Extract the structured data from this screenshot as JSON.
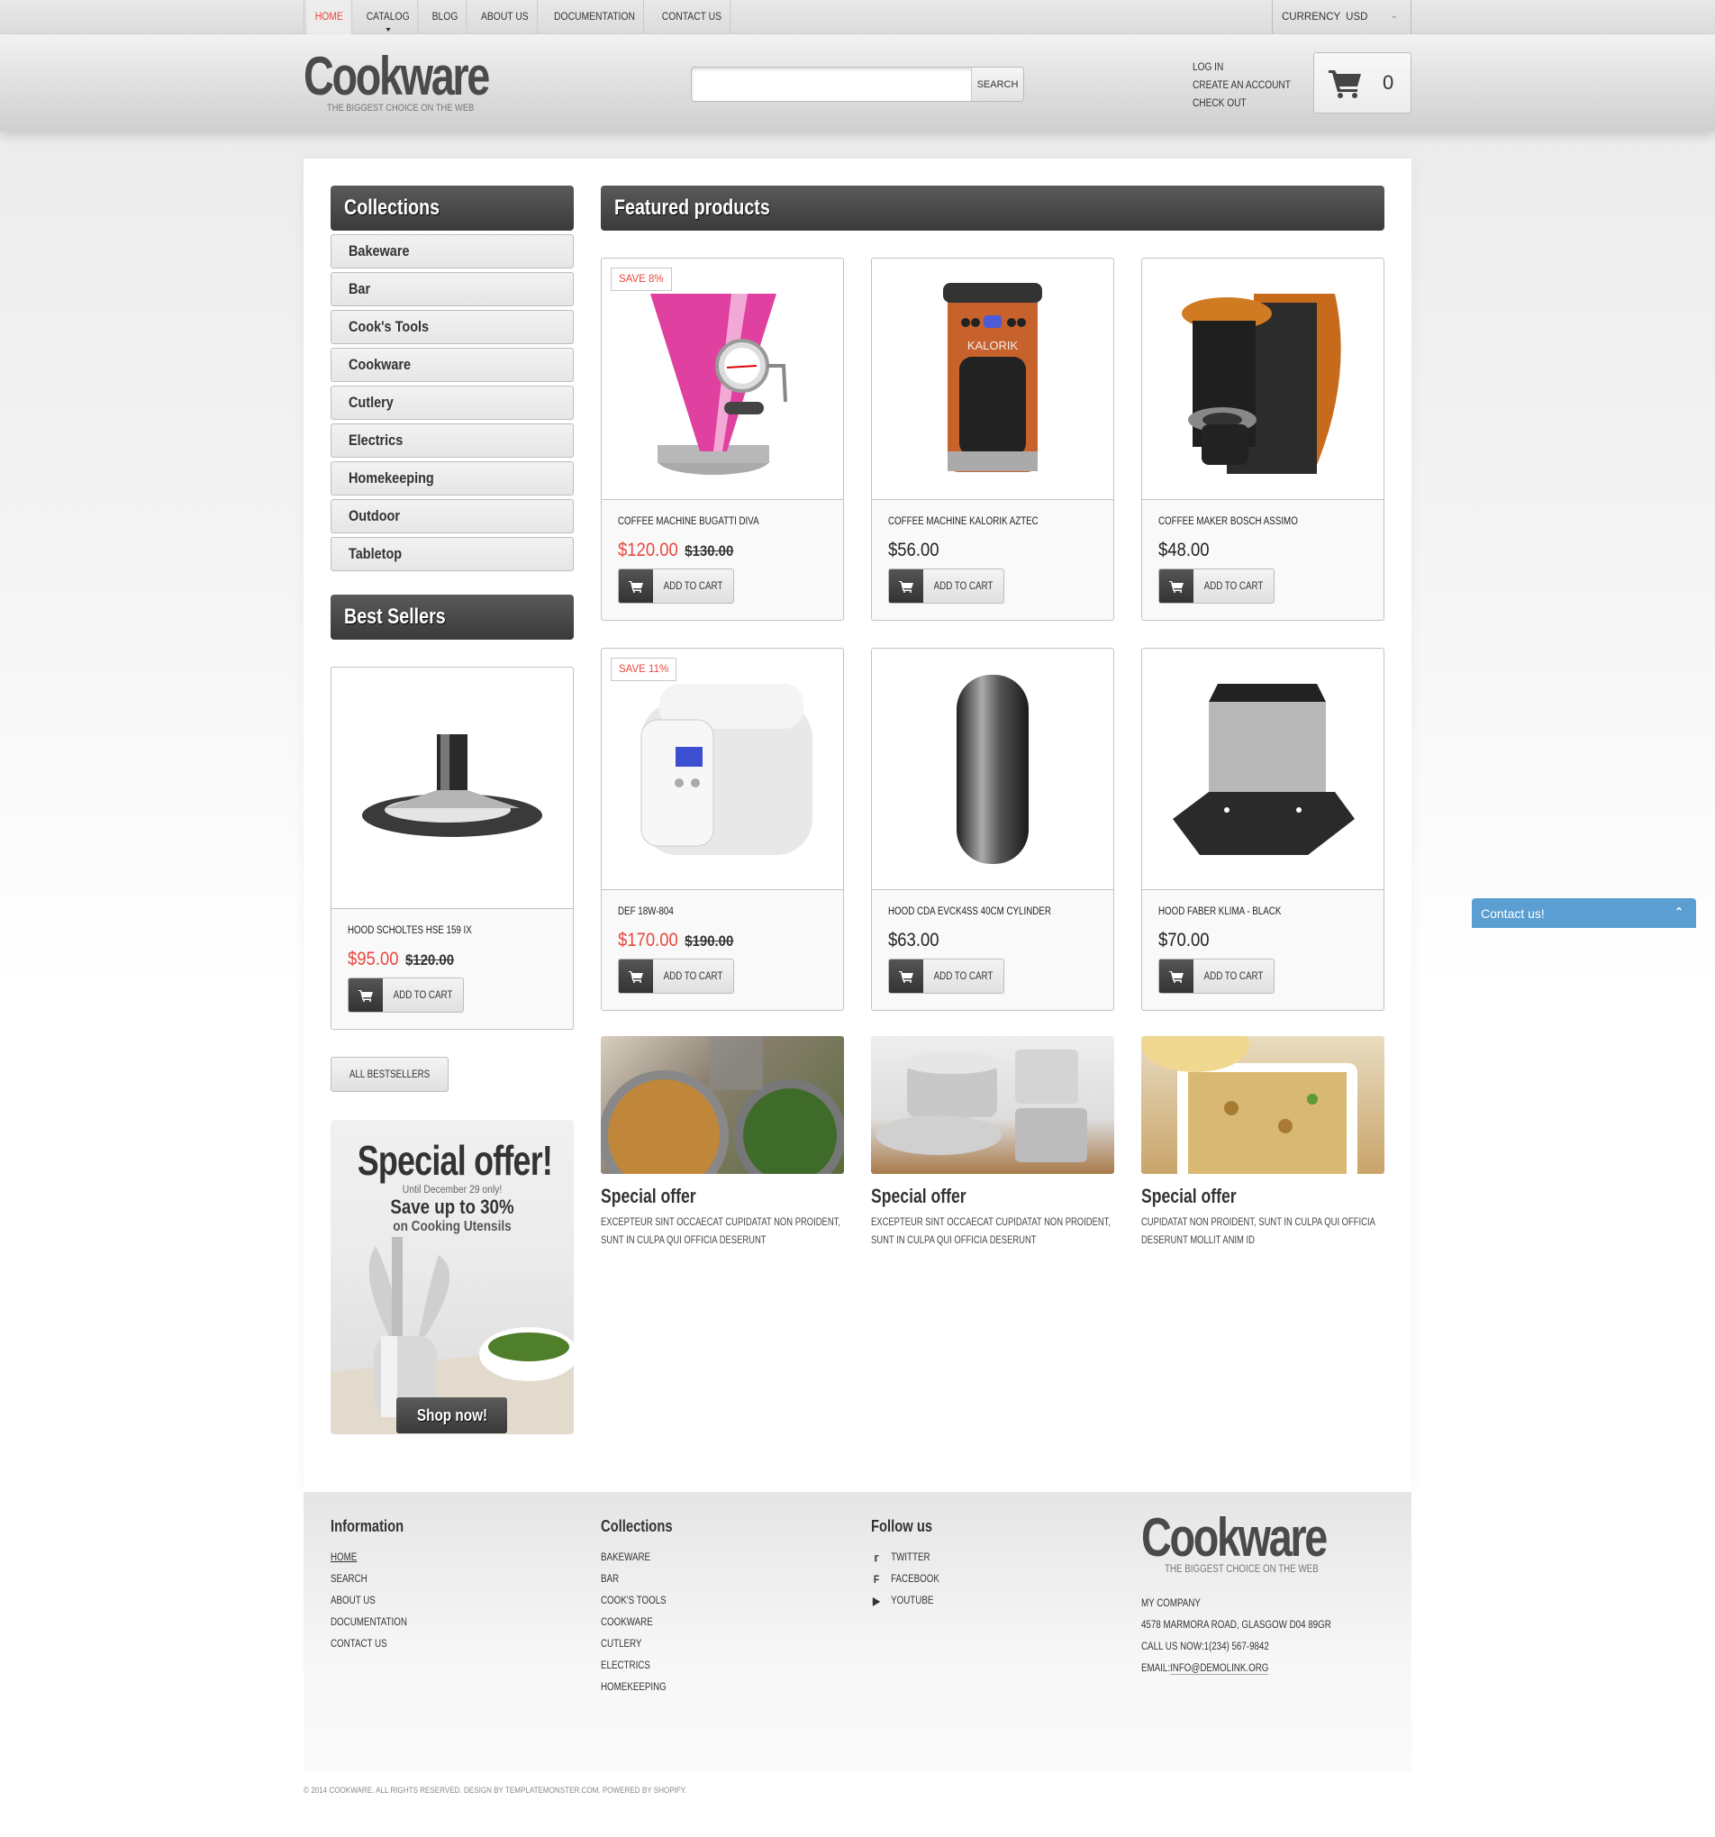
{
  "topnav": {
    "items": [
      {
        "label": "HOME",
        "active": true
      },
      {
        "label": "CATALOG",
        "dropdown": true
      },
      {
        "label": "BLOG"
      },
      {
        "label": "ABOUT US"
      },
      {
        "label": "DOCUMENTATION"
      },
      {
        "label": "CONTACT US"
      }
    ],
    "currency_label": "CURRENCY",
    "currency_value": "USD"
  },
  "header": {
    "logo": "Cookware",
    "tagline": "THE BIGGEST CHOICE ON THE WEB",
    "search_placeholder": "",
    "search_button": "SEARCH",
    "account_links": [
      "LOG IN",
      "CREATE AN ACCOUNT",
      "CHECK OUT"
    ],
    "cart_count": "0"
  },
  "sidebar": {
    "collections_title": "Collections",
    "collections": [
      "Bakeware",
      "Bar",
      "Cook's Tools",
      "Cookware",
      "Cutlery",
      "Electrics",
      "Homekeeping",
      "Outdoor",
      "Tabletop"
    ],
    "bestsellers_title": "Best Sellers",
    "bestseller": {
      "name": "HOOD SCHOLTES HSE 159 IX",
      "price": "$95.00",
      "old_price": "$120.00",
      "add_to_cart": "ADD TO CART"
    },
    "all_bestsellers": "ALL BESTSELLERS",
    "promo": {
      "title": "Special offer!",
      "until": "Until December 29 only!",
      "save": "Save up to 30%",
      "sub": "on Cooking Utensils",
      "button": "Shop now!"
    }
  },
  "main": {
    "featured_title": "Featured products",
    "products": [
      {
        "name": "COFFEE MACHINE BUGATTI DIVA",
        "price": "$120.00",
        "old_price": "$130.00",
        "badge": "SAVE 8%",
        "add_to_cart": "ADD TO CART"
      },
      {
        "name": "COFFEE MACHINE KALORIK AZTEC",
        "price": "$56.00",
        "add_to_cart": "ADD TO CART"
      },
      {
        "name": "COFFEE MAKER BOSCH ASSIMO",
        "price": "$48.00",
        "add_to_cart": "ADD TO CART"
      },
      {
        "name": "DEF 18W-804",
        "price": "$170.00",
        "old_price": "$190.00",
        "badge": "SAVE 11%",
        "add_to_cart": "ADD TO CART"
      },
      {
        "name": "HOOD CDA EVCK4SS 40CM CYLINDER",
        "price": "$63.00",
        "add_to_cart": "ADD TO CART"
      },
      {
        "name": "HOOD FABER KLIMA - BLACK",
        "price": "$70.00",
        "add_to_cart": "ADD TO CART"
      }
    ],
    "offers": [
      {
        "title": "Special offer",
        "text": "EXCEPTEUR SINT OCCAECAT CUPIDATAT NON PROIDENT, SUNT IN CULPA QUI OFFICIA DESERUNT"
      },
      {
        "title": "Special offer",
        "text": "EXCEPTEUR SINT OCCAECAT CUPIDATAT NON PROIDENT, SUNT IN CULPA QUI OFFICIA DESERUNT"
      },
      {
        "title": "Special offer",
        "text": "CUPIDATAT NON PROIDENT, SUNT IN CULPA QUI OFFICIA DESERUNT MOLLIT ANIM ID"
      }
    ]
  },
  "footer": {
    "information_title": "Information",
    "information_links": [
      "HOME",
      "SEARCH",
      "ABOUT US",
      "DOCUMENTATION",
      "CONTACT US"
    ],
    "collections_title": "Collections",
    "collections_links": [
      "BAKEWARE",
      "BAR",
      "COOK'S TOOLS",
      "COOKWARE",
      "CUTLERY",
      "ELECTRICS",
      "HOMEKEEPING"
    ],
    "follow_title": "Follow us",
    "social": [
      {
        "icon": "twitter-icon",
        "label": "TWITTER"
      },
      {
        "icon": "facebook-icon",
        "label": "FACEBOOK"
      },
      {
        "icon": "youtube-icon",
        "label": "YOUTUBE"
      }
    ],
    "logo": "Cookware",
    "tagline": "THE BIGGEST CHOICE ON THE WEB",
    "company": "MY COMPANY",
    "address": "4578 MARMORA ROAD, GLASGOW D04 89GR",
    "phone": "CALL US NOW:1(234) 567-9842",
    "email_label": "EMAIL:",
    "email": "INFO@DEMOLINK.ORG",
    "copyright": "© 2014 COOKWARE. ALL RIGHTS RESERVED. DESIGN BY TEMPLATEMONSTER.COM. POWERED BY SHOPIFY."
  },
  "contact_widget": {
    "label": "Contact us!"
  },
  "colors": {
    "accent": "#e8473f",
    "dark_panel": "#444444",
    "contact_widget": "#5b9fd2"
  }
}
